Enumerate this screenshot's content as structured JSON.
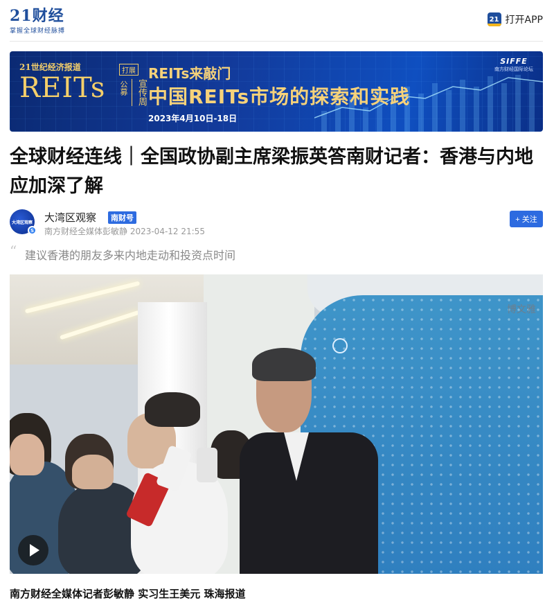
{
  "header": {
    "logo_title": "21财经",
    "logo_slogan": "掌握全球财经脉搏",
    "app_icon_text": "21",
    "open_app_label": "打开APP"
  },
  "banner": {
    "paper_name": "21世纪经济报道",
    "tag": "打展",
    "reits_big": "REITs",
    "gongyi": "公募",
    "xuanchuan": "宣传周",
    "line1": "REITs来敲门",
    "line2": "中国REITs市场的探索和实践",
    "date": "2023年4月10日-18日",
    "siffe_logo": "SIFFE",
    "siffe_name": "南方财经国际论坛"
  },
  "article": {
    "title": "全球财经连线｜全国政协副主席梁振英答南财记者：香港与内地应加深了解",
    "summary": "建议香港的朋友多来内地走动和投资点时间",
    "byline": "南方财经全媒体记者彭敏静 实习生王美元 珠海报道"
  },
  "author": {
    "avatar_text": "大湾区观察",
    "avatar_badge": "S",
    "name": "大湾区观察",
    "tag": "南财号",
    "meta": "南方财经全媒体彭敏静 2023-04-12 21:55",
    "follow_label": "+ 关注"
  },
  "photo": {
    "wall_text": "博文雅"
  },
  "colors": {
    "brand": "#1f4e9c",
    "accent": "#2d6be0",
    "banner_gold": "#f6d27a"
  },
  "icons": {
    "quote": "quote-icon",
    "play": "play-icon"
  }
}
